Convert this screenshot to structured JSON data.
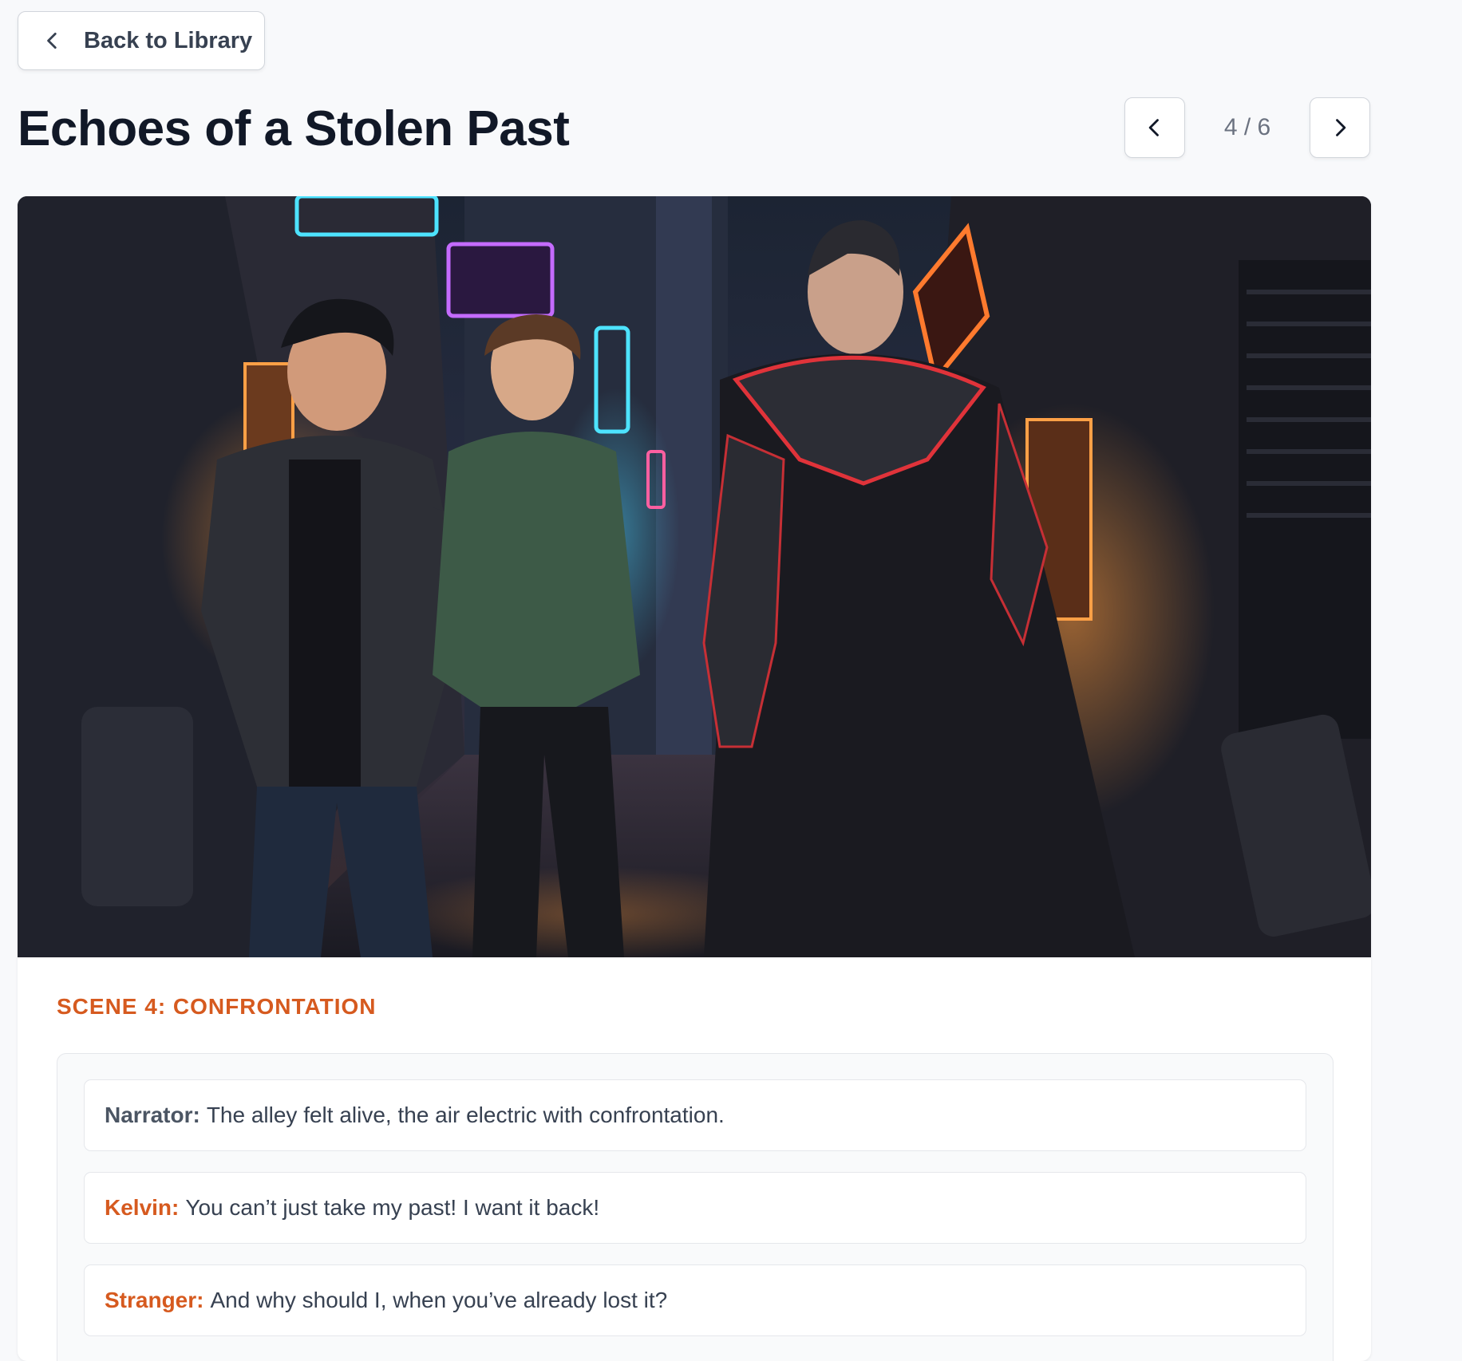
{
  "back_button": {
    "label": "Back to Library",
    "icon": "chevron-left-icon"
  },
  "story": {
    "title": "Echoes of a Stolen Past"
  },
  "pager": {
    "indicator": "4 / 6",
    "prev_icon": "chevron-left-icon",
    "next_icon": "chevron-right-icon"
  },
  "scene": {
    "heading": "SCENE 4: CONFRONTATION",
    "dialogue": [
      {
        "speaker": "Narrator:",
        "text": "The alley felt alive, the air electric with confrontation.",
        "role": "narrator"
      },
      {
        "speaker": "Kelvin:",
        "text": "You can’t just take my past! I want it back!",
        "role": "character"
      },
      {
        "speaker": "Stranger:",
        "text": "And why should I, when you’ve already lost it?",
        "role": "character"
      }
    ]
  },
  "colors": {
    "accent": "#d65a1f",
    "background": "#f8f9fb",
    "narrator": "#4b5563"
  }
}
